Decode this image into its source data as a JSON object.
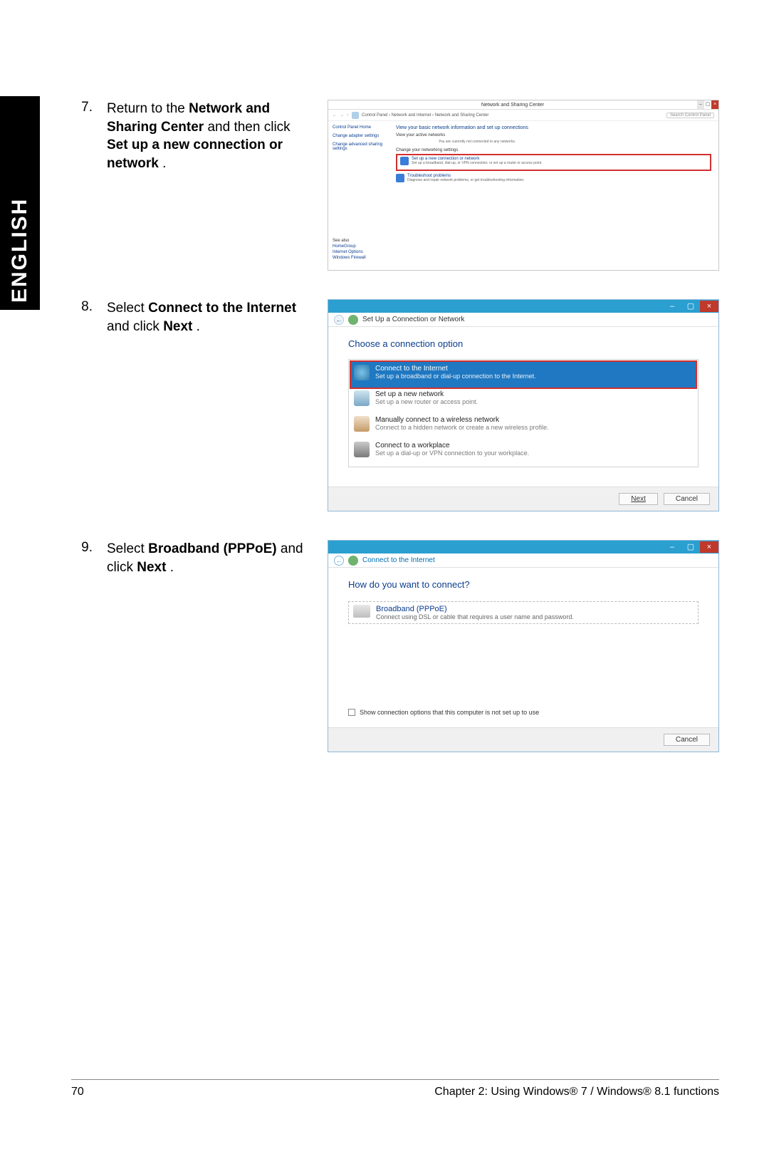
{
  "sidebar_label": "ENGLISH",
  "steps": {
    "s7": {
      "num": "7.",
      "text_parts": [
        "Return to the ",
        "Network and Sharing Center",
        " and then click ",
        "Set up a new connection or network",
        "."
      ]
    },
    "s8": {
      "num": "8.",
      "text_parts": [
        "Select ",
        "Connect to the Internet",
        " and click ",
        "Next",
        "."
      ]
    },
    "s9": {
      "num": "9.",
      "text_parts": [
        "Select ",
        "Broadband (PPPoE)",
        " and click ",
        "Next",
        "."
      ]
    }
  },
  "shot1": {
    "window_title": "Network and Sharing Center",
    "breadcrumb": "Control Panel  ›  Network and Internet  ›  Network and Sharing Center",
    "search_placeholder": "Search Control Panel",
    "left_links": [
      "Control Panel Home",
      "Change adapter settings",
      "Change advanced sharing settings"
    ],
    "see_also_header": "See also",
    "see_also": [
      "HomeGroup",
      "Internet Options",
      "Windows Firewall"
    ],
    "main_header": "View your basic network information and set up connections",
    "active_label": "View your active networks",
    "active_note": "You are currently not connected to any networks.",
    "change_header": "Change your networking settings",
    "item1_title": "Set up a new connection or network",
    "item1_desc": "Set up a broadband, dial-up, or VPN connection; or set up a router or access point.",
    "item2_title": "Troubleshoot problems",
    "item2_desc": "Diagnose and repair network problems, or get troubleshooting information."
  },
  "shot2": {
    "window_title": "Set Up a Connection or Network",
    "question": "Choose a connection option",
    "opt1_title": "Connect to the Internet",
    "opt1_desc": "Set up a broadband or dial-up connection to the Internet.",
    "opt2_title": "Set up a new network",
    "opt2_desc": "Set up a new router or access point.",
    "opt3_title": "Manually connect to a wireless network",
    "opt3_desc": "Connect to a hidden network or create a new wireless profile.",
    "opt4_title": "Connect to a workplace",
    "opt4_desc": "Set up a dial-up or VPN connection to your workplace.",
    "next_label": "Next",
    "cancel_label": "Cancel"
  },
  "shot3": {
    "window_title": "Connect to the Internet",
    "question": "How do you want to connect?",
    "bb_title": "Broadband (PPPoE)",
    "bb_desc": "Connect using DSL or cable that requires a user name and password.",
    "checkbox_label": "Show connection options that this computer is not set up to use",
    "cancel_label": "Cancel"
  },
  "footer": {
    "page_number": "70",
    "chapter": "Chapter 2: Using Windows® 7 / Windows® 8.1 functions"
  }
}
